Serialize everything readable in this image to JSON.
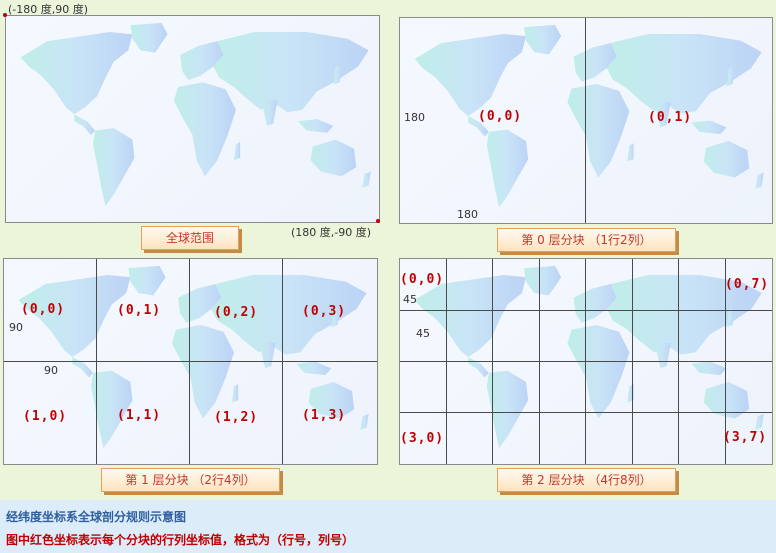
{
  "panels": {
    "global": {
      "corner_top_left": "(-180 度,90 度)",
      "corner_bottom_right": "(180 度,-90 度)",
      "tag": "全球范围"
    },
    "level0": {
      "side_label": "180",
      "bottom_label": "180",
      "tag": "第 0 层分块 （1行2列）",
      "cells": [
        "(0,0)",
        "(0,1)"
      ]
    },
    "level1": {
      "side_label": "90",
      "bottom_label": "90",
      "tag": "第 1 层分块 （2行4列）",
      "cells": [
        "(0,0)",
        "(0,1)",
        "(0,2)",
        "(0,3)",
        "(1,0)",
        "(1,1)",
        "(1,2)",
        "(1,3)"
      ]
    },
    "level2": {
      "side_label": "45",
      "bottom_label": "45",
      "tag": "第 2 层分块 （4行8列）",
      "cells": [
        "(0,0)",
        "(0,7)",
        "(3,0)",
        "(3,7)"
      ]
    }
  },
  "captions": {
    "title": "经纬度坐标系全球剖分规则示意图",
    "note": "图中红色坐标表示每个分块的行列坐标值，格式为（行号，列号）"
  },
  "colors": {
    "coord_red": "#c00000",
    "caption_blue": "#2f5fa0",
    "grid_line": "#4a4a4a"
  }
}
